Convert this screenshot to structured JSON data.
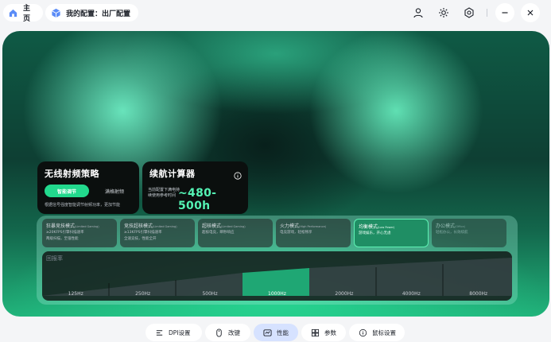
{
  "breadcrumb": {
    "home": "主页",
    "config": "我的配置：出厂配置"
  },
  "header_icons": [
    "user-icon",
    "brightness-icon",
    "settings-icon",
    "minimize-icon",
    "close-icon"
  ],
  "strategy": {
    "title": "无线射频策略",
    "options": [
      "智能调节",
      "满格射频"
    ],
    "selected": "智能调节",
    "description": "根据信号强度智能调节射频功率，更加节能"
  },
  "range": {
    "title": "续航计算器",
    "note": "当前配置下满电持续使用参考时间",
    "value": "~480-500h"
  },
  "modes": [
    {
      "title": "狂暴竞技模式",
      "subtitle": "(Limited Gaming)",
      "desc1": "≥20KFPS引擎扫描速率",
      "desc2": "两级扫描，至强性能",
      "state": "normal"
    },
    {
      "title": "竞技超核模式",
      "subtitle": "(Limited Gaming)",
      "desc1": "≥13KFPS引擎扫描速率",
      "desc2": "全速竞技，性能全开",
      "state": "normal"
    },
    {
      "title": "超核模式",
      "subtitle": "(Limited Gaming)",
      "desc1": "超核电竞，瞬秒响应",
      "desc2": "",
      "state": "normal"
    },
    {
      "title": "火力模式",
      "subtitle": "(High Performance)",
      "desc1": "电竞游戏，轻松畅享",
      "desc2": "",
      "state": "normal"
    },
    {
      "title": "均衡模式",
      "subtitle": "(Low Power)",
      "desc1": "游戏娱乐，开心无虑",
      "desc2": "",
      "state": "active"
    },
    {
      "title": "办公模式",
      "subtitle": "(Office)",
      "desc1": "轻松办公，长效续航",
      "desc2": "",
      "state": "dim"
    }
  ],
  "polling": {
    "label": "回报率",
    "rates": [
      "125Hz",
      "250Hz",
      "500Hz",
      "1000Hz",
      "2000Hz",
      "4000Hz",
      "8000Hz"
    ],
    "selected": "1000Hz"
  },
  "tabs": [
    {
      "label": "DPI设置",
      "icon": "dpi-icon"
    },
    {
      "label": "改键",
      "icon": "mouse-icon"
    },
    {
      "label": "性能",
      "icon": "performance-icon",
      "active": true
    },
    {
      "label": "参数",
      "icon": "grid-icon"
    },
    {
      "label": "鼠标设置",
      "icon": "info-icon"
    }
  ],
  "colors": {
    "accent": "#22d98d",
    "active_tab": "#d6e2ff"
  }
}
